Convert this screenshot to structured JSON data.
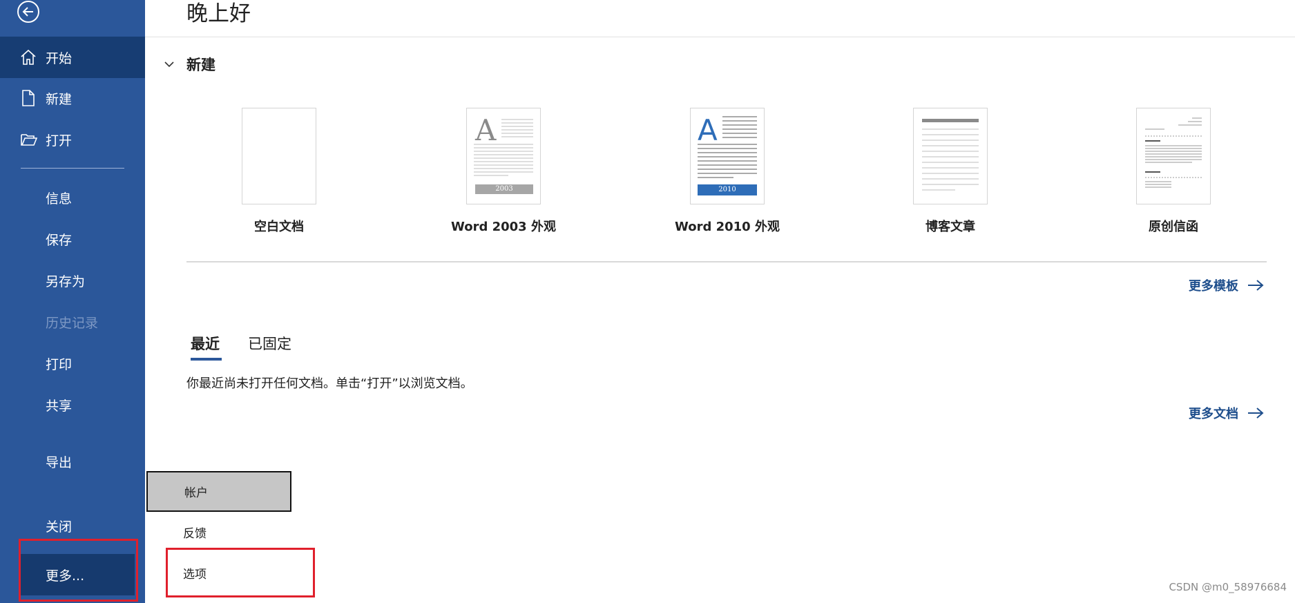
{
  "header": {
    "greeting": "晚上好"
  },
  "sidebar": {
    "items": [
      {
        "label": "开始",
        "icon": "home-icon"
      },
      {
        "label": "新建",
        "icon": "new-document-icon"
      },
      {
        "label": "打开",
        "icon": "folder-open-icon"
      },
      {
        "label": "信息"
      },
      {
        "label": "保存"
      },
      {
        "label": "另存为"
      },
      {
        "label": "历史记录"
      },
      {
        "label": "打印"
      },
      {
        "label": "共享"
      },
      {
        "label": "导出"
      },
      {
        "label": "关闭"
      },
      {
        "label": "更多..."
      }
    ]
  },
  "new_section": {
    "title": "新建",
    "templates": [
      {
        "name": "空白文档"
      },
      {
        "name": "Word 2003 外观",
        "badge": "2003"
      },
      {
        "name": "Word 2010 外观",
        "badge": "2010"
      },
      {
        "name": "博客文章"
      },
      {
        "name": "原创信函"
      }
    ],
    "more_templates": "更多模板"
  },
  "recent": {
    "tabs": [
      "最近",
      "已固定"
    ],
    "empty_message": "你最近尚未打开任何文档。单击“打开”以浏览文档。",
    "more_documents": "更多文档"
  },
  "more_menu": {
    "items": [
      {
        "label": "帐户"
      },
      {
        "label": "反馈"
      },
      {
        "label": "选项"
      }
    ]
  },
  "watermark": "CSDN @m0_58976684",
  "colors": {
    "sidebar": "#2b579a",
    "sidebar_active": "#173d73",
    "link": "#1e4e8c",
    "highlight_box": "#e0202c"
  }
}
